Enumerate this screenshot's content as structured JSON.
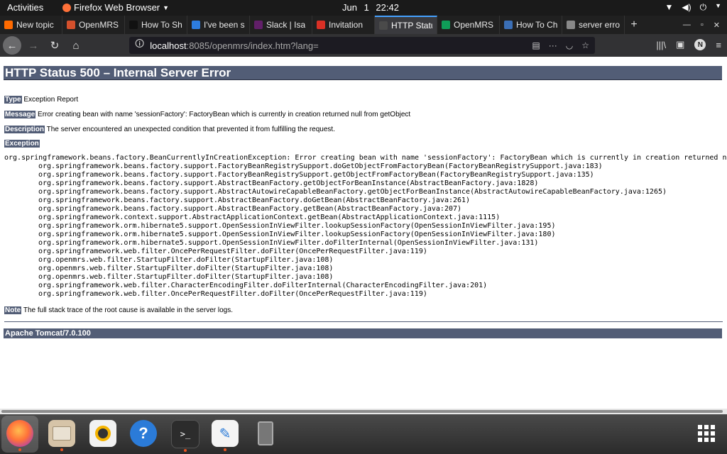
{
  "topbar": {
    "activities": "Activities",
    "app_name": "Firefox Web Browser",
    "clock": "Jun 1  22:42"
  },
  "tabs": [
    {
      "label": "New topic",
      "icon": "discourse-icon",
      "color": "#ff6a00"
    },
    {
      "label": "OpenMRS",
      "icon": "openmrs-icon",
      "color": "#d4502c"
    },
    {
      "label": "How To Sh",
      "icon": "medium-icon",
      "color": "#111111"
    },
    {
      "label": "I've been s",
      "icon": "vscode-icon",
      "color": "#2d7de0"
    },
    {
      "label": "Slack | Isa",
      "icon": "slack-icon",
      "color": "#611f69"
    },
    {
      "label": "Invitation",
      "icon": "gmail-icon",
      "color": "#d93025"
    },
    {
      "label": "HTTP Statu",
      "icon": "page-icon",
      "color": "#4a4a4a",
      "active": true
    },
    {
      "label": "OpenMRS",
      "icon": "sheets-icon",
      "color": "#0f9d58"
    },
    {
      "label": "How To Ch",
      "icon": "globe-icon",
      "color": "#3b6fb6"
    },
    {
      "label": "server erro",
      "icon": "doc-icon",
      "color": "#888888"
    }
  ],
  "navbar": {
    "url_host": "localhost",
    "url_rest": ":8085/openmrs/index.htm?lang=",
    "profile_initial": "N"
  },
  "page": {
    "title": "HTTP Status 500 – Internal Server Error",
    "type_label": "Type",
    "type_value": "Exception Report",
    "message_label": "Message",
    "message_value": "Error creating bean with name 'sessionFactory': FactoryBean which is currently in creation returned null from getObject",
    "description_label": "Description",
    "description_value": "The server encountered an unexpected condition that prevented it from fulfilling the request.",
    "exception_label": "Exception",
    "exception_first": "org.springframework.beans.factory.BeanCurrentlyInCreationException: Error creating bean with name 'sessionFactory': FactoryBean which is currently in creation returned null from getObject",
    "stack": [
      "org.springframework.beans.factory.support.FactoryBeanRegistrySupport.doGetObjectFromFactoryBean(FactoryBeanRegistrySupport.java:183)",
      "org.springframework.beans.factory.support.FactoryBeanRegistrySupport.getObjectFromFactoryBean(FactoryBeanRegistrySupport.java:135)",
      "org.springframework.beans.factory.support.AbstractBeanFactory.getObjectForBeanInstance(AbstractBeanFactory.java:1828)",
      "org.springframework.beans.factory.support.AbstractAutowireCapableBeanFactory.getObjectForBeanInstance(AbstractAutowireCapableBeanFactory.java:1265)",
      "org.springframework.beans.factory.support.AbstractBeanFactory.doGetBean(AbstractBeanFactory.java:261)",
      "org.springframework.beans.factory.support.AbstractBeanFactory.getBean(AbstractBeanFactory.java:207)",
      "org.springframework.context.support.AbstractApplicationContext.getBean(AbstractApplicationContext.java:1115)",
      "org.springframework.orm.hibernate5.support.OpenSessionInViewFilter.lookupSessionFactory(OpenSessionInViewFilter.java:195)",
      "org.springframework.orm.hibernate5.support.OpenSessionInViewFilter.lookupSessionFactory(OpenSessionInViewFilter.java:180)",
      "org.springframework.orm.hibernate5.support.OpenSessionInViewFilter.doFilterInternal(OpenSessionInViewFilter.java:131)",
      "org.springframework.web.filter.OncePerRequestFilter.doFilter(OncePerRequestFilter.java:119)",
      "org.openmrs.web.filter.StartupFilter.doFilter(StartupFilter.java:108)",
      "org.openmrs.web.filter.StartupFilter.doFilter(StartupFilter.java:108)",
      "org.openmrs.web.filter.StartupFilter.doFilter(StartupFilter.java:108)",
      "org.springframework.web.filter.CharacterEncodingFilter.doFilterInternal(CharacterEncodingFilter.java:201)",
      "org.springframework.web.filter.OncePerRequestFilter.doFilter(OncePerRequestFilter.java:119)"
    ],
    "note_label": "Note",
    "note_value": "The full stack trace of the root cause is available in the server logs.",
    "footer": "Apache Tomcat/7.0.100"
  },
  "dock": [
    {
      "name": "firefox-icon",
      "active": true
    },
    {
      "name": "files-icon",
      "active": true
    },
    {
      "name": "rhythmbox-icon",
      "active": false
    },
    {
      "name": "help-icon",
      "active": false
    },
    {
      "name": "terminal-icon",
      "active": true
    },
    {
      "name": "text-editor-icon",
      "active": true
    },
    {
      "name": "usb-drive-icon",
      "active": false
    },
    {
      "name": "show-apps-icon",
      "active": false
    }
  ]
}
